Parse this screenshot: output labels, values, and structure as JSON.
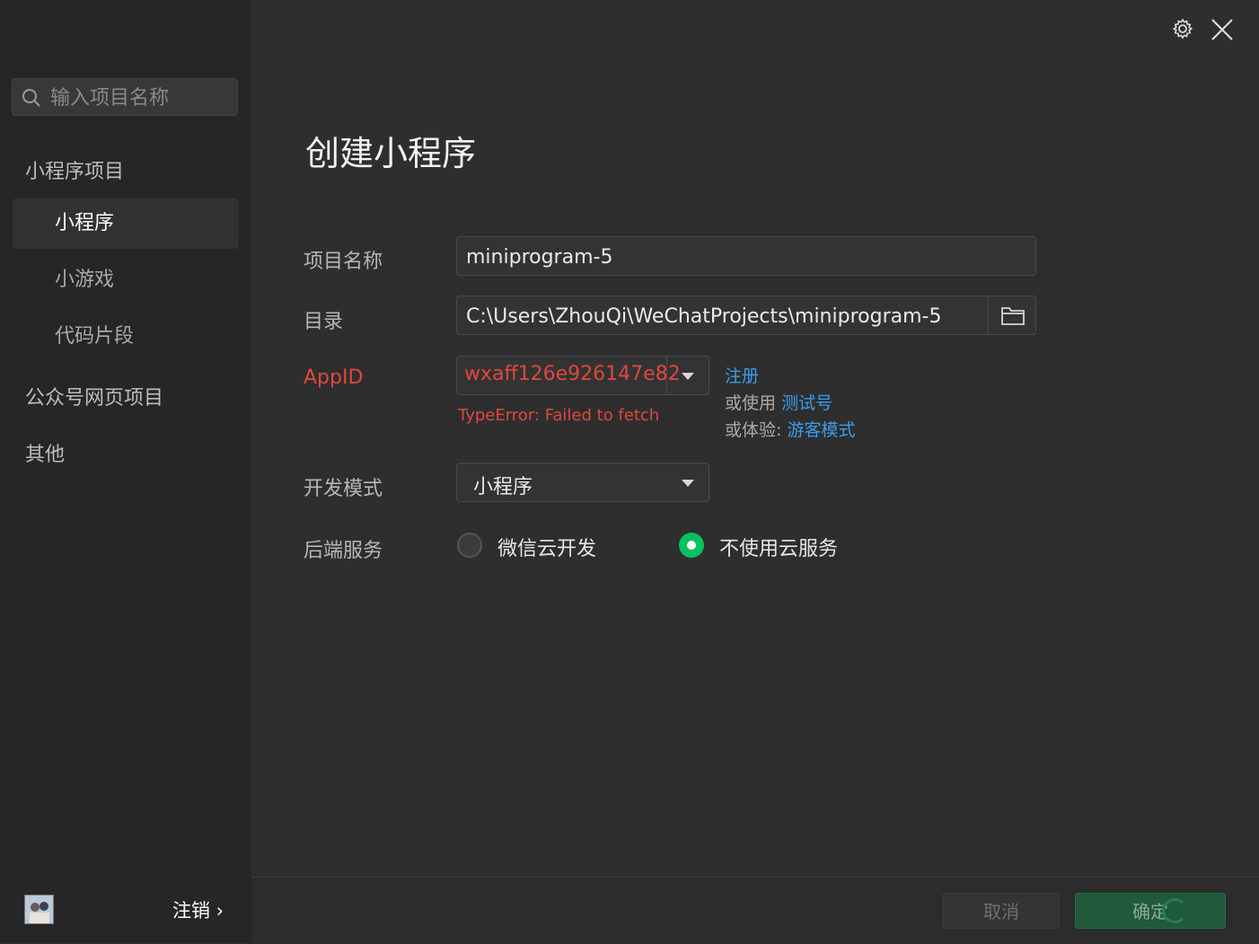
{
  "search": {
    "placeholder": "输入项目名称"
  },
  "sidebar": {
    "group_miniprogram": "小程序项目",
    "items": [
      {
        "label": "小程序",
        "active": true
      },
      {
        "label": "小游戏"
      },
      {
        "label": "代码片段"
      }
    ],
    "group_official": "公众号网页项目",
    "group_other": "其他",
    "logout_label": "注销 ›"
  },
  "title": "创建小程序",
  "form": {
    "project_name_label": "项目名称",
    "project_name_value": "miniprogram-5",
    "dir_label": "目录",
    "dir_value": "C:\\Users\\ZhouQi\\WeChatProjects\\miniprogram-5",
    "appid_label": "AppID",
    "appid_value": "wxaff126e926147e82",
    "appid_error": "TypeError: Failed to fetch",
    "register_link": "注册",
    "use_prefix": "或使用",
    "test_account_link": "测试号",
    "experience_prefix": "或体验:",
    "guest_mode_link": "游客模式",
    "dev_mode_label": "开发模式",
    "dev_mode_value": "小程序",
    "backend_label": "后端服务",
    "backend_options": [
      {
        "label": "微信云开发",
        "selected": false
      },
      {
        "label": "不使用云服务",
        "selected": true
      }
    ]
  },
  "buttons": {
    "cancel": "取消",
    "confirm": "确定"
  },
  "colors": {
    "accent_green": "#07c160",
    "error_red": "#e0473e",
    "link_blue": "#3b9cf0"
  },
  "icons": [
    "search-icon",
    "gear-icon",
    "close-icon",
    "folder-icon",
    "dropdown-arrow-icon",
    "avatar"
  ]
}
